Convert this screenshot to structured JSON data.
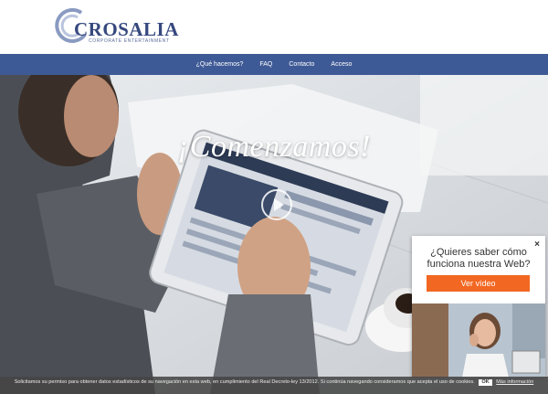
{
  "logo": {
    "name": "CROSALIA",
    "subtitle": "CORPORATE ENTERTAINMENT"
  },
  "nav": {
    "items": [
      {
        "label": "¿Qué hacemos?"
      },
      {
        "label": "FAQ"
      },
      {
        "label": "Contacto"
      },
      {
        "label": "Acceso"
      }
    ]
  },
  "hero": {
    "title": "¡Comenzamos!"
  },
  "popup": {
    "question": "¿Quieres saber cómo funciona nuestra Web?",
    "button": "Ver vídeo",
    "close": "×"
  },
  "cookie": {
    "text": "Solicitamos su permiso para obtener datos estadísticos de su navegación en esta web, en cumplimiento del Real Decreto-ley 13/2012. Si continúa navegando consideramos que acepta el uso de cookies.",
    "ok": "OK",
    "more": "Más información"
  },
  "colors": {
    "brand": "#36487e",
    "nav_bg": "#3e5a96",
    "cta": "#f26722"
  }
}
